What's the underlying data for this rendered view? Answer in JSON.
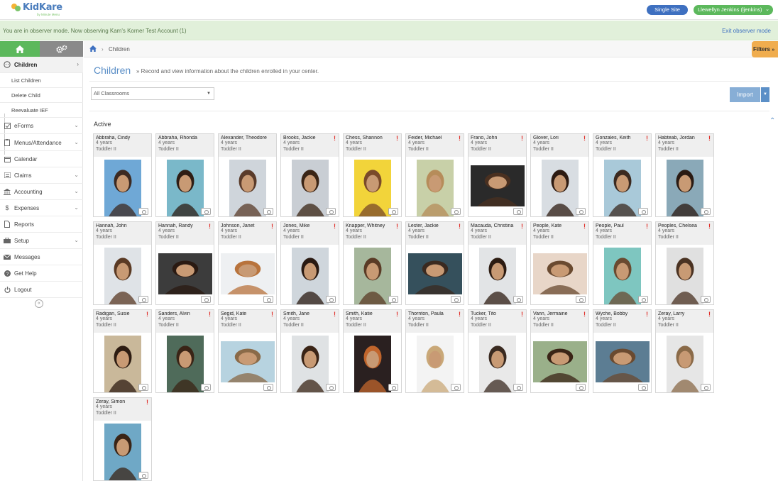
{
  "header": {
    "logo_text": "KidKare",
    "logo_sub": "by Minute Menu",
    "site_button": "Single Site",
    "user_button": "Llewellyn Jenkins (ljenkins)"
  },
  "observer": {
    "message": "You are in observer mode. Now observing Kam's Korner Test Account (1)",
    "exit": "Exit observer mode"
  },
  "sidebar": {
    "items": [
      {
        "label": "Children",
        "icon": "child-face-icon"
      },
      {
        "label": "eForms",
        "icon": "checkbox-icon"
      },
      {
        "label": "Menus/Attendance",
        "icon": "clipboard-icon"
      },
      {
        "label": "Calendar",
        "icon": "calendar-icon"
      },
      {
        "label": "Claims",
        "icon": "list-icon"
      },
      {
        "label": "Accounting",
        "icon": "bank-icon"
      },
      {
        "label": "Expenses",
        "icon": "dollar-icon"
      },
      {
        "label": "Reports",
        "icon": "document-icon"
      },
      {
        "label": "Setup",
        "icon": "briefcase-icon"
      },
      {
        "label": "Messages",
        "icon": "envelope-icon"
      },
      {
        "label": "Get Help",
        "icon": "help-icon"
      },
      {
        "label": "Logout",
        "icon": "power-icon"
      }
    ],
    "sub_items": [
      "List Children",
      "Delete Child",
      "Reevaluate IEF"
    ]
  },
  "breadcrumb": {
    "current": "Children",
    "filters": "Filters"
  },
  "page": {
    "title": "Children",
    "subtitle": "» Record and view information about the children enrolled in your center.",
    "classroom_select": "All Classrooms",
    "import_label": "Import",
    "section_label": "Active"
  },
  "children": [
    {
      "name": "Abbraha, Cindy",
      "age": "4 years",
      "room": "Toddler II",
      "alert": false
    },
    {
      "name": "Abbraha, Rhonda",
      "age": "4 years",
      "room": "Toddler II",
      "alert": false
    },
    {
      "name": "Alexander, Theodore",
      "age": "4 years",
      "room": "Toddler II",
      "alert": false
    },
    {
      "name": "Brooks, Jackie",
      "age": "4 years",
      "room": "Toddler II",
      "alert": true
    },
    {
      "name": "Chess, Shannon",
      "age": "4 years",
      "room": "Toddler II",
      "alert": true
    },
    {
      "name": "Feider, Michael",
      "age": "4 years",
      "room": "Toddler II",
      "alert": true
    },
    {
      "name": "Frano, John",
      "age": "4 years",
      "room": "Toddler II",
      "alert": true
    },
    {
      "name": "Glover, Lori",
      "age": "4 years",
      "room": "Toddler II",
      "alert": true
    },
    {
      "name": "Gonzales, Keith",
      "age": "4 years",
      "room": "Toddler II",
      "alert": true
    },
    {
      "name": "Habteab, Jordan",
      "age": "4 years",
      "room": "Toddler II",
      "alert": true
    },
    {
      "name": "Hannah, John",
      "age": "4 years",
      "room": "Toddler II",
      "alert": false
    },
    {
      "name": "Hannah, Randy",
      "age": "4 years",
      "room": "Toddler II",
      "alert": true
    },
    {
      "name": "Johnson, Janet",
      "age": "4 years",
      "room": "Toddler II",
      "alert": true
    },
    {
      "name": "Jones, Mike",
      "age": "4 years",
      "room": "Toddler II",
      "alert": true
    },
    {
      "name": "Knapper, Whitney",
      "age": "4 years",
      "room": "Toddler II",
      "alert": true
    },
    {
      "name": "Lester, Jackie",
      "age": "4 years",
      "room": "Toddler II",
      "alert": true
    },
    {
      "name": "Macauda, Christina",
      "age": "4 years",
      "room": "Toddler II",
      "alert": true
    },
    {
      "name": "People, Kate",
      "age": "4 years",
      "room": "Toddler II",
      "alert": true
    },
    {
      "name": "People, Paul",
      "age": "4 years",
      "room": "Toddler II",
      "alert": true
    },
    {
      "name": "Peoples, Chelsea",
      "age": "4 years",
      "room": "Toddler II",
      "alert": true
    },
    {
      "name": "Radigan, Susie",
      "age": "4 years",
      "room": "Toddler II",
      "alert": true
    },
    {
      "name": "Sanders, Alvin",
      "age": "4 years",
      "room": "Toddler II",
      "alert": true
    },
    {
      "name": "Segid, Kate",
      "age": "4 years",
      "room": "Toddler II",
      "alert": true
    },
    {
      "name": "Smith, Jane",
      "age": "4 years",
      "room": "Toddler II",
      "alert": true
    },
    {
      "name": "Smith, Katie",
      "age": "4 years",
      "room": "Toddler II",
      "alert": true
    },
    {
      "name": "Thornton, Paula",
      "age": "4 years",
      "room": "Toddler II",
      "alert": true
    },
    {
      "name": "Tucker, Tito",
      "age": "4 years",
      "room": "Toddler II",
      "alert": true
    },
    {
      "name": "Vann, Jermaine",
      "age": "4 years",
      "room": "Toddler II",
      "alert": true
    },
    {
      "name": "Wyche, Bobby",
      "age": "4 years",
      "room": "Toddler II",
      "alert": true
    },
    {
      "name": "Zeray, Larry",
      "age": "4 years",
      "room": "Toddler II",
      "alert": true
    },
    {
      "name": "Zeray, Simon",
      "age": "4 years",
      "room": "Toddler II",
      "alert": true
    }
  ],
  "colors": {
    "brand_blue": "#3e70c0",
    "brand_green": "#5cb85c",
    "alert_red": "#e0302b",
    "filters_orange": "#f0ad4e"
  }
}
